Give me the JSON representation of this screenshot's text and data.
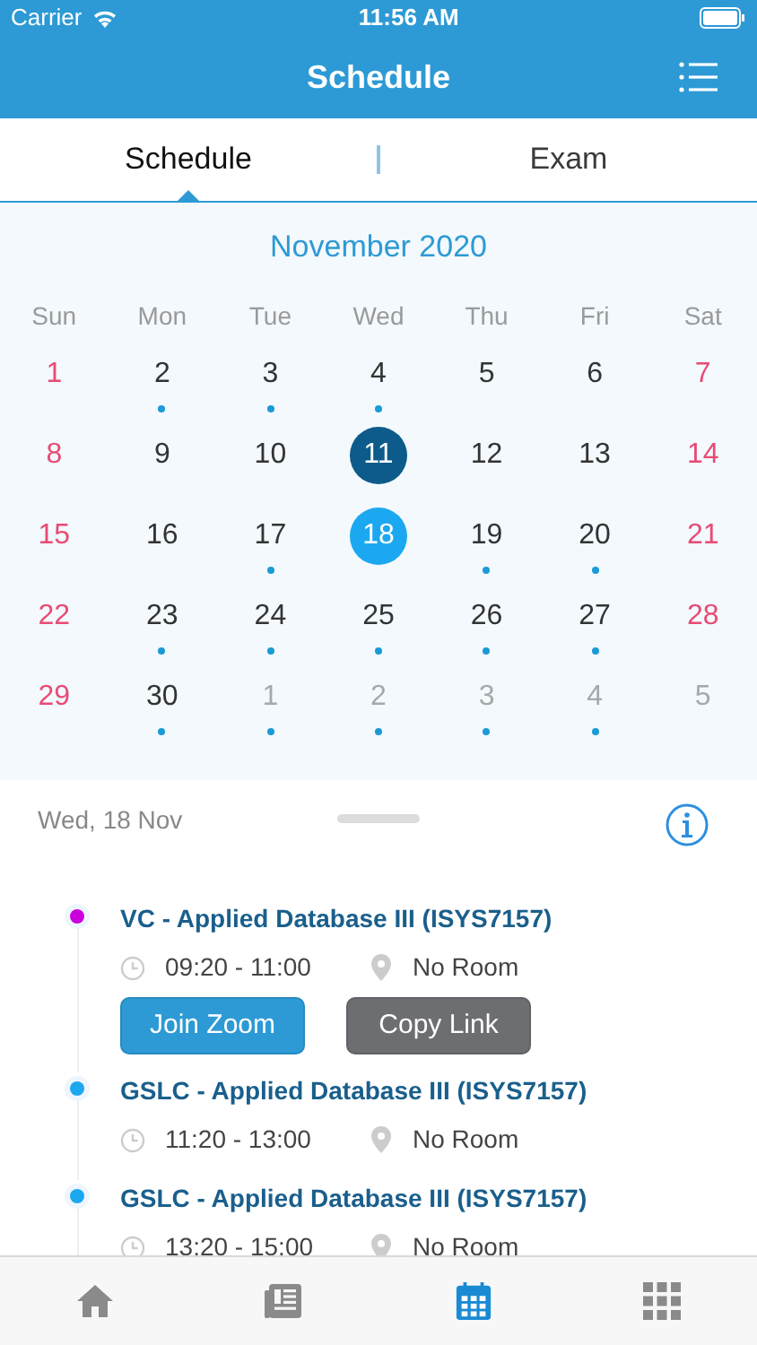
{
  "status_bar": {
    "carrier": "Carrier",
    "time": "11:56 AM"
  },
  "nav": {
    "title": "Schedule"
  },
  "tabs": [
    {
      "label": "Schedule",
      "selected": true
    },
    {
      "label": "Exam",
      "selected": false
    }
  ],
  "calendar": {
    "month": "November 2020",
    "weekdays": [
      "Sun",
      "Mon",
      "Tue",
      "Wed",
      "Thu",
      "Fri",
      "Sat"
    ],
    "weeks": [
      [
        {
          "day": "1",
          "kind": "weekend",
          "event": false,
          "selected": false,
          "today": false
        },
        {
          "day": "2",
          "kind": "weekday",
          "event": true,
          "selected": false,
          "today": false
        },
        {
          "day": "3",
          "kind": "weekday",
          "event": true,
          "selected": false,
          "today": false
        },
        {
          "day": "4",
          "kind": "weekday",
          "event": true,
          "selected": false,
          "today": false
        },
        {
          "day": "5",
          "kind": "weekday",
          "event": false,
          "selected": false,
          "today": false
        },
        {
          "day": "6",
          "kind": "weekday",
          "event": false,
          "selected": false,
          "today": false
        },
        {
          "day": "7",
          "kind": "weekend",
          "event": false,
          "selected": false,
          "today": false
        }
      ],
      [
        {
          "day": "8",
          "kind": "weekend",
          "event": false,
          "selected": false,
          "today": false
        },
        {
          "day": "9",
          "kind": "weekday",
          "event": false,
          "selected": false,
          "today": false
        },
        {
          "day": "10",
          "kind": "weekday",
          "event": false,
          "selected": false,
          "today": false
        },
        {
          "day": "11",
          "kind": "weekday",
          "event": false,
          "selected": false,
          "today": true
        },
        {
          "day": "12",
          "kind": "weekday",
          "event": false,
          "selected": false,
          "today": false
        },
        {
          "day": "13",
          "kind": "weekday",
          "event": false,
          "selected": false,
          "today": false
        },
        {
          "day": "14",
          "kind": "weekend",
          "event": false,
          "selected": false,
          "today": false
        }
      ],
      [
        {
          "day": "15",
          "kind": "weekend",
          "event": false,
          "selected": false,
          "today": false
        },
        {
          "day": "16",
          "kind": "weekday",
          "event": false,
          "selected": false,
          "today": false
        },
        {
          "day": "17",
          "kind": "weekday",
          "event": true,
          "selected": false,
          "today": false
        },
        {
          "day": "18",
          "kind": "weekday",
          "event": false,
          "selected": true,
          "today": false
        },
        {
          "day": "19",
          "kind": "weekday",
          "event": true,
          "selected": false,
          "today": false
        },
        {
          "day": "20",
          "kind": "weekday",
          "event": true,
          "selected": false,
          "today": false
        },
        {
          "day": "21",
          "kind": "weekend",
          "event": false,
          "selected": false,
          "today": false
        }
      ],
      [
        {
          "day": "22",
          "kind": "weekend",
          "event": false,
          "selected": false,
          "today": false
        },
        {
          "day": "23",
          "kind": "weekday",
          "event": true,
          "selected": false,
          "today": false
        },
        {
          "day": "24",
          "kind": "weekday",
          "event": true,
          "selected": false,
          "today": false
        },
        {
          "day": "25",
          "kind": "weekday",
          "event": true,
          "selected": false,
          "today": false
        },
        {
          "day": "26",
          "kind": "weekday",
          "event": true,
          "selected": false,
          "today": false
        },
        {
          "day": "27",
          "kind": "weekday",
          "event": true,
          "selected": false,
          "today": false
        },
        {
          "day": "28",
          "kind": "weekend",
          "event": false,
          "selected": false,
          "today": false
        }
      ],
      [
        {
          "day": "29",
          "kind": "weekend",
          "event": false,
          "selected": false,
          "today": false
        },
        {
          "day": "30",
          "kind": "weekday",
          "event": true,
          "selected": false,
          "today": false
        },
        {
          "day": "1",
          "kind": "other",
          "event": true,
          "selected": false,
          "today": false
        },
        {
          "day": "2",
          "kind": "other",
          "event": true,
          "selected": false,
          "today": false
        },
        {
          "day": "3",
          "kind": "other",
          "event": true,
          "selected": false,
          "today": false
        },
        {
          "day": "4",
          "kind": "other",
          "event": true,
          "selected": false,
          "today": false
        },
        {
          "day": "5",
          "kind": "other",
          "event": false,
          "selected": false,
          "today": false
        }
      ]
    ]
  },
  "agenda": {
    "date": "Wed, 18 Nov",
    "events": [
      {
        "title": "VC - Applied Database III (ISYS7157)",
        "color": "#cc00dd",
        "time": "09:20 - 11:00",
        "room": "No Room",
        "buttons": [
          {
            "label": "Join Zoom",
            "kind": "primary"
          },
          {
            "label": "Copy Link",
            "kind": "secondary"
          }
        ]
      },
      {
        "title": "GSLC - Applied Database III (ISYS7157)",
        "color": "#1ca8f0",
        "time": "11:20 - 13:00",
        "room": "No Room"
      },
      {
        "title": "GSLC - Applied Database III (ISYS7157)",
        "color": "#1ca8f0",
        "time": "13:20 - 15:00",
        "room": "No Room"
      }
    ]
  },
  "tab_bar": [
    {
      "kind": "home",
      "selected": false
    },
    {
      "kind": "news",
      "selected": false
    },
    {
      "kind": "calendar",
      "selected": true
    },
    {
      "kind": "grid",
      "selected": false
    }
  ]
}
